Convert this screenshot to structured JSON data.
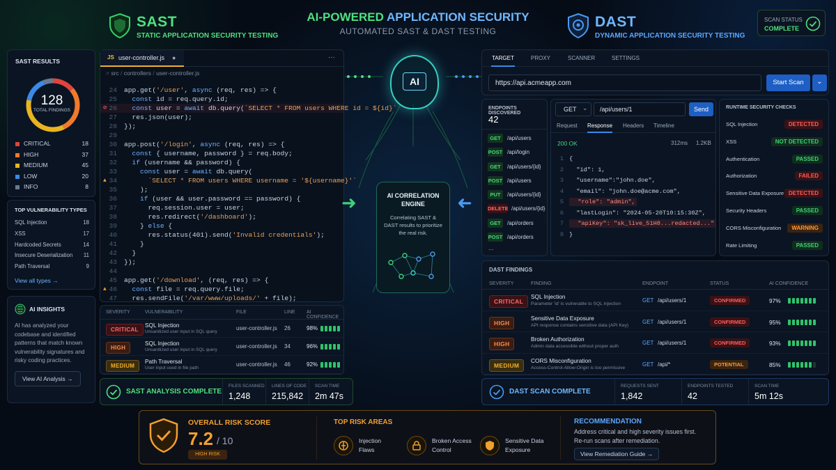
{
  "header": {
    "sast_title": "SAST",
    "sast_subtitle": "STATIC APPLICATION SECURITY TESTING",
    "center_title_a": "AI-POWERED",
    "center_title_b": "APPLICATION SECURITY",
    "center_subtitle": "AUTOMATED SAST & DAST TESTING",
    "dast_title": "DAST",
    "dast_subtitle": "DYNAMIC APPLICATION SECURITY TESTING",
    "scan_status_label": "SCAN STATUS",
    "scan_status_value": "COMPLETE"
  },
  "sast_results": {
    "title": "SAST RESULTS",
    "total": "128",
    "total_label": "TOTAL FINDINGS",
    "rows": [
      {
        "label": "CRITICAL",
        "count": "18",
        "color": "#e0443a"
      },
      {
        "label": "HIGH",
        "count": "37",
        "color": "#f07a2a"
      },
      {
        "label": "MEDIUM",
        "count": "45",
        "color": "#e8b420"
      },
      {
        "label": "LOW",
        "count": "20",
        "color": "#3a8ae8"
      },
      {
        "label": "INFO",
        "count": "8",
        "color": "#6a7890"
      }
    ]
  },
  "top_vulns": {
    "title": "TOP VULNERABILITY TYPES",
    "items": [
      {
        "label": "SQL Injection",
        "count": "18"
      },
      {
        "label": "XSS",
        "count": "17"
      },
      {
        "label": "Hardcoded Secrets",
        "count": "14"
      },
      {
        "label": "Insecure Deserialization",
        "count": "11"
      },
      {
        "label": "Path Traversal",
        "count": "9"
      }
    ],
    "view_all": "View all types"
  },
  "ai_insights": {
    "title": "AI INSIGHTS",
    "body": "AI has analyzed your codebase and identified patterns that match known vulnerability signatures and risky coding practices.",
    "button": "View AI Analysis"
  },
  "editor": {
    "file_tab": "user-controller.js",
    "file_icon": "JS",
    "breadcrumb": [
      "src",
      "controllers",
      "user-controller.js"
    ],
    "menu": "···",
    "lines": [
      {
        "n": "24",
        "t": "app.get('/user', async (req, res) => {",
        "mark": ""
      },
      {
        "n": "25",
        "t": "  const id = req.query.id;",
        "mark": ""
      },
      {
        "n": "26",
        "t": "  const user = await db.query(`SELECT * FROM users WHERE id = ${id}`",
        "mark": "error"
      },
      {
        "n": "27",
        "t": "  res.json(user);",
        "mark": ""
      },
      {
        "n": "28",
        "t": "});",
        "mark": ""
      },
      {
        "n": "29",
        "t": "",
        "mark": ""
      },
      {
        "n": "30",
        "t": "app.post('/login', async (req, res) => {",
        "mark": ""
      },
      {
        "n": "31",
        "t": "  const { username, password } = req.body;",
        "mark": ""
      },
      {
        "n": "32",
        "t": "  if (username && password) {",
        "mark": ""
      },
      {
        "n": "33",
        "t": "    const user = await db.query(",
        "mark": ""
      },
      {
        "n": "34",
        "t": "      `SELECT * FROM users WHERE username = '${username}'`",
        "mark": "warn"
      },
      {
        "n": "35",
        "t": "    );",
        "mark": ""
      },
      {
        "n": "36",
        "t": "    if (user && user.password == password) {",
        "mark": ""
      },
      {
        "n": "37",
        "t": "      req.session.user = user;",
        "mark": ""
      },
      {
        "n": "38",
        "t": "      res.redirect('/dashboard');",
        "mark": ""
      },
      {
        "n": "39",
        "t": "    } else {",
        "mark": ""
      },
      {
        "n": "40",
        "t": "      res.status(401).send('Invalid credentials');",
        "mark": ""
      },
      {
        "n": "41",
        "t": "    }",
        "mark": ""
      },
      {
        "n": "42",
        "t": "  }",
        "mark": ""
      },
      {
        "n": "43",
        "t": "});",
        "mark": ""
      },
      {
        "n": "44",
        "t": "",
        "mark": ""
      },
      {
        "n": "45",
        "t": "app.get('/download', (req, res) => {",
        "mark": ""
      },
      {
        "n": "46",
        "t": "  const file = req.query.file;",
        "mark": "warn"
      },
      {
        "n": "47",
        "t": "  res.sendFile('/var/www/uploads/' + file);",
        "mark": ""
      }
    ]
  },
  "sast_table": {
    "headers": [
      "SEVERITY",
      "VULNERABILITY",
      "FILE",
      "LINE",
      "AI CONFIDENCE"
    ],
    "rows": [
      {
        "sev": "CRITICAL",
        "cls": "critical",
        "name": "SQL Injection",
        "desc": "Unsanitized user input in SQL query",
        "file": "user-controller.js",
        "line": "26",
        "conf": "98%",
        "bars": 5
      },
      {
        "sev": "HIGH",
        "cls": "high",
        "name": "SQL Injection",
        "desc": "Unsanitized user input in SQL query",
        "file": "user-controller.js",
        "line": "34",
        "conf": "96%",
        "bars": 5
      },
      {
        "sev": "MEDIUM",
        "cls": "medium",
        "name": "Path Traversal",
        "desc": "User input used in file path",
        "file": "user-controller.js",
        "line": "46",
        "conf": "92%",
        "bars": 5
      }
    ]
  },
  "sast_complete": {
    "label": "SAST ANALYSIS COMPLETE",
    "stats": [
      {
        "label": "FILES SCANNED",
        "value": "1,248"
      },
      {
        "label": "LINES OF CODE",
        "value": "215,842"
      },
      {
        "label": "SCAN TIME",
        "value": "2m 47s"
      }
    ]
  },
  "ai_center": {
    "chip": "AI",
    "engine_title": "AI CORRELATION ENGINE",
    "engine_body": "Correlating SAST & DAST results to prioritize the real risk."
  },
  "dast_tabs": [
    "TARGET",
    "PROXY",
    "SCANNER",
    "SETTINGS"
  ],
  "dast_target": {
    "url": "https://api.acmeapp.com",
    "button": "Start Scan"
  },
  "endpoints": {
    "title": "ENDPOINTS DISCOVERED",
    "count": "42",
    "items": [
      {
        "m": "GET",
        "c": "m-get",
        "p": "/api/users"
      },
      {
        "m": "POST",
        "c": "m-post",
        "p": "/api/login"
      },
      {
        "m": "GET",
        "c": "m-get",
        "p": "/api/users/{id}"
      },
      {
        "m": "POST",
        "c": "m-post",
        "p": "/api/users"
      },
      {
        "m": "PUT",
        "c": "m-put",
        "p": "/api/users/{id}"
      },
      {
        "m": "DELETE",
        "c": "m-delete",
        "p": "/api/users/{id}"
      },
      {
        "m": "GET",
        "c": "m-get",
        "p": "/api/orders"
      },
      {
        "m": "POST",
        "c": "m-post",
        "p": "/api/orders"
      }
    ],
    "more": "..."
  },
  "request": {
    "method": "GET",
    "path": "/api/users/1",
    "send": "Send",
    "tabs": [
      "Request",
      "Response",
      "Headers",
      "Timeline"
    ],
    "status": "200 OK",
    "time": "312ms",
    "size": "1.2KB",
    "lines": [
      {
        "n": "1",
        "t": "{",
        "hl": false
      },
      {
        "n": "2",
        "t": "  \"id\": 1,",
        "hl": false
      },
      {
        "n": "3",
        "t": "  \"username\":\"john.doe\",",
        "hl": false
      },
      {
        "n": "4",
        "t": "  \"email\": \"john.doe@acme.com\",",
        "hl": false
      },
      {
        "n": "5",
        "t": "  \"role\": \"admin\",",
        "hl": true
      },
      {
        "n": "6",
        "t": "  \"lastLogin\": \"2024-05-20T10:15:30Z\",",
        "hl": false
      },
      {
        "n": "7",
        "t": "  \"apiKey\": \"sk_live_51H8...redacted...\"",
        "hl": true
      },
      {
        "n": "8",
        "t": "}",
        "hl": false
      }
    ]
  },
  "runtime": {
    "title": "RUNTIME SECURITY CHECKS",
    "items": [
      {
        "label": "SQL Injection",
        "status": "DETECTED",
        "c": "red"
      },
      {
        "label": "XSS",
        "status": "NOT DETECTED",
        "c": "green"
      },
      {
        "label": "Authentication",
        "status": "PASSED",
        "c": "green"
      },
      {
        "label": "Authorization",
        "status": "FAILED",
        "c": "red"
      },
      {
        "label": "Sensitive Data Exposure",
        "status": "DETECTED",
        "c": "red"
      },
      {
        "label": "Security Headers",
        "status": "PASSED",
        "c": "green"
      },
      {
        "label": "CORS Misconfiguration",
        "status": "WARNING",
        "c": "orange"
      },
      {
        "label": "Rate Limiting",
        "status": "PASSED",
        "c": "green"
      }
    ]
  },
  "dast_findings": {
    "title": "DAST FINDINGS",
    "headers": [
      "SEVERITY",
      "FINDING",
      "ENDPOINT",
      "STATUS",
      "AI CONFIDENCE"
    ],
    "rows": [
      {
        "sev": "CRITICAL",
        "cls": "critical",
        "name": "SQL Injection",
        "desc": "Parameter 'id' is vulnerable to SQL injection",
        "method": "GET",
        "ep": "/api/users/1",
        "status": "CONFIRMED",
        "sc": "red",
        "conf": "97%",
        "bars": 7
      },
      {
        "sev": "HIGH",
        "cls": "high",
        "name": "Sensitive Data Exposure",
        "desc": "API response contains sensitive data (API Key)",
        "method": "GET",
        "ep": "/api/users/1",
        "status": "CONFIRMED",
        "sc": "red",
        "conf": "95%",
        "bars": 7
      },
      {
        "sev": "HIGH",
        "cls": "high",
        "name": "Broken Authorization",
        "desc": "Admin data accessible without proper auth",
        "method": "GET",
        "ep": "/api/users/1",
        "status": "CONFIRMED",
        "sc": "red",
        "conf": "93%",
        "bars": 7
      },
      {
        "sev": "MEDIUM",
        "cls": "medium",
        "name": "CORS Misconfiguration",
        "desc": "Access-Control-Allow-Origin is too permissive",
        "method": "GET",
        "ep": "/api/*",
        "status": "POTENTIAL",
        "sc": "orange",
        "conf": "85%",
        "bars": 6
      }
    ]
  },
  "dast_complete": {
    "label": "DAST SCAN COMPLETE",
    "stats": [
      {
        "label": "REQUESTS SENT",
        "value": "1,842"
      },
      {
        "label": "ENDPOINTS TESTED",
        "value": "42"
      },
      {
        "label": "SCAN TIME",
        "value": "5m 12s"
      }
    ]
  },
  "risk": {
    "title": "OVERALL RISK SCORE",
    "score": "7.2",
    "of": "/ 10",
    "badge": "HIGH RISK",
    "areas_title": "TOP RISK AREAS",
    "areas": [
      {
        "a": "Injection",
        "b": "Flaws",
        "icon": "syringe-icon"
      },
      {
        "a": "Broken Access",
        "b": "Control",
        "icon": "lock-icon"
      },
      {
        "a": "Sensitive Data",
        "b": "Exposure",
        "icon": "shield-icon"
      }
    ],
    "rec_title": "RECOMMENDATION",
    "rec_body_1": "Address critical and high severity issues first.",
    "rec_body_2": "Re-run scans after remediation.",
    "rec_button": "View Remediation Guide"
  },
  "colors": {
    "green": "#2ec46a",
    "blue": "#3a8ae8",
    "orange": "#f0a030",
    "red": "#ff5b5b"
  }
}
